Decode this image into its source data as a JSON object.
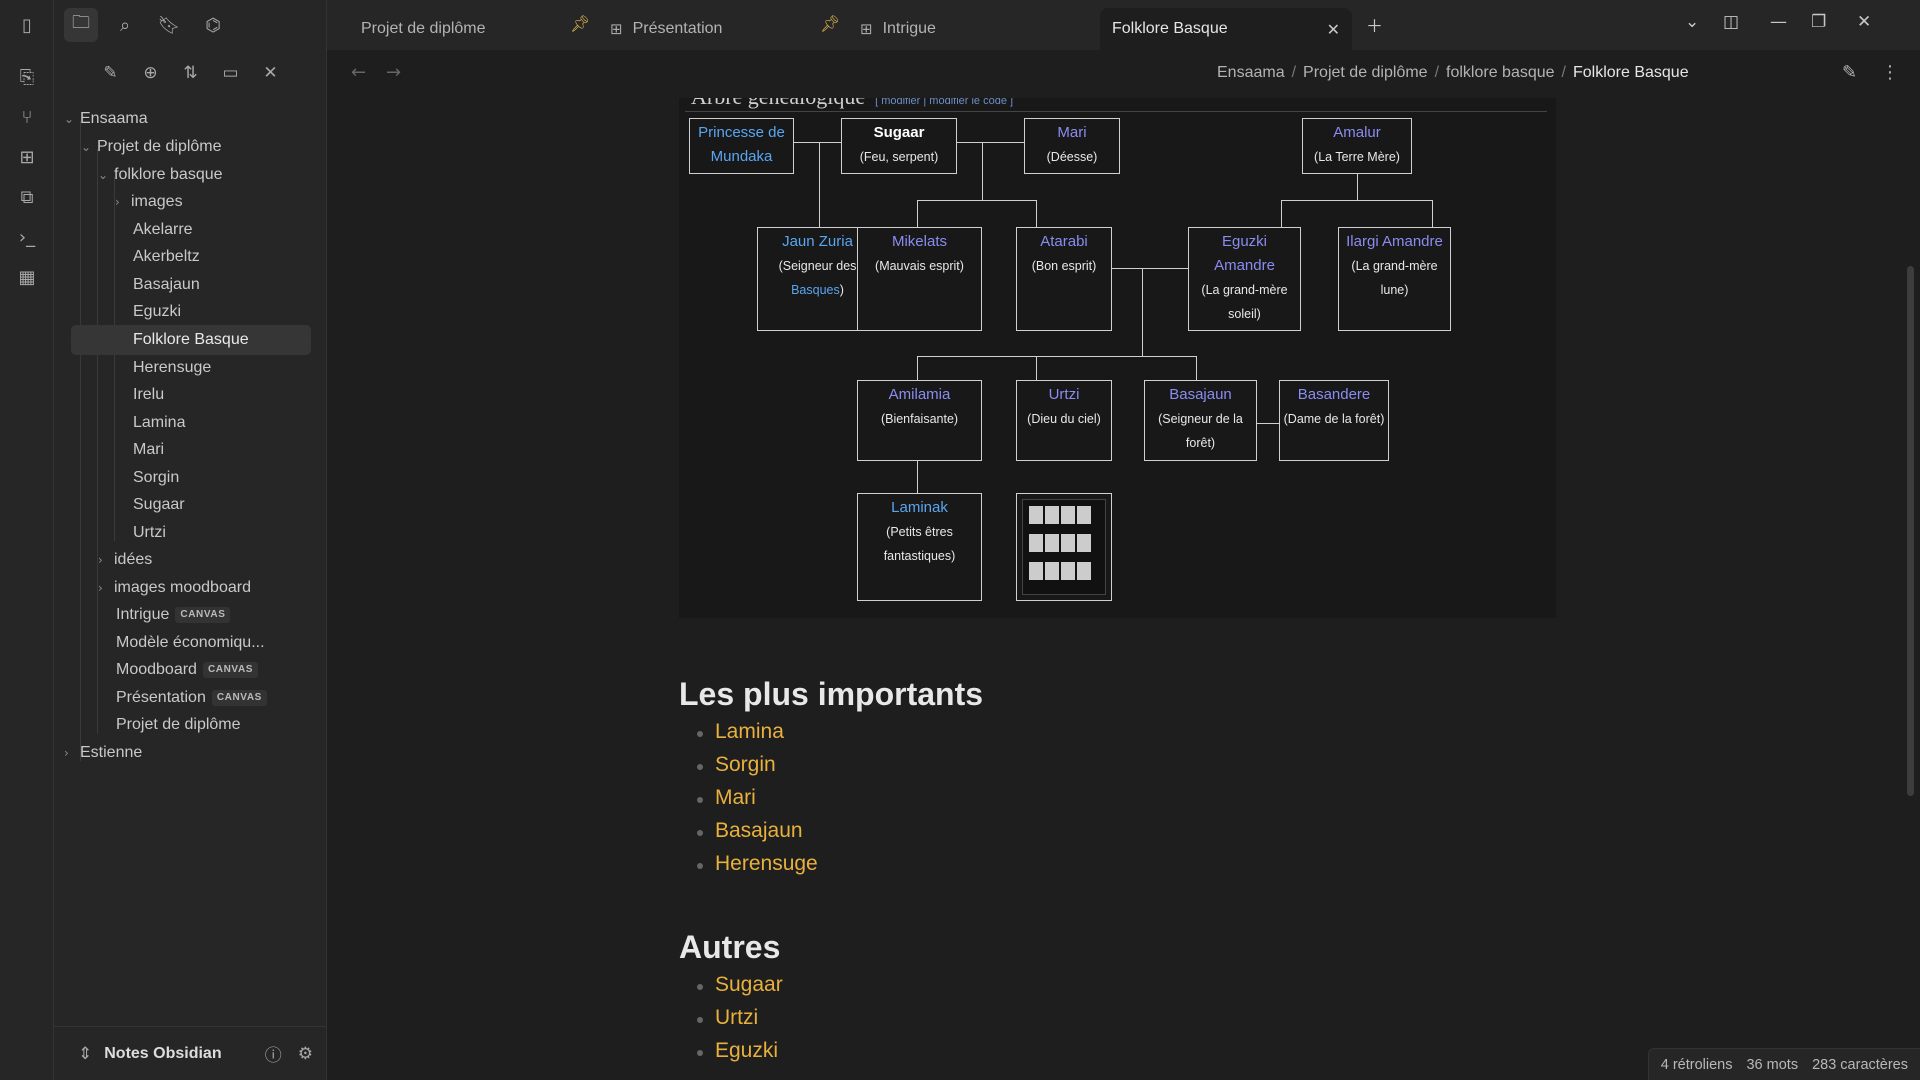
{
  "tabs": [
    {
      "label": "Projet de diplôme",
      "pinned": true
    },
    {
      "label": "Présentation",
      "pinned": true,
      "icon": "canvas-icon"
    },
    {
      "label": "Intrigue",
      "icon": "canvas-icon"
    },
    {
      "label": "Folklore Basque",
      "active": true
    }
  ],
  "breadcrumb": [
    "Ensaama",
    "Projet de diplôme",
    "folklore basque",
    "Folklore Basque"
  ],
  "tree": {
    "root1": "Ensaama",
    "projet": "Projet de diplôme",
    "folklore": "folklore basque",
    "images": "images",
    "files": [
      "Akelarre",
      "Akerbeltz",
      "Basajaun",
      "Eguzki",
      "Folklore Basque",
      "Herensuge",
      "Irelu",
      "Lamina",
      "Mari",
      "Sorgin",
      "Sugaar",
      "Urtzi"
    ],
    "idees": "idées",
    "moodboard_folder": "images moodboard",
    "intrigue": "Intrigue",
    "modele": "Modèle économiqu...",
    "moodboard": "Moodboard",
    "presentation": "Présentation",
    "projet_file": "Projet de diplôme",
    "root2": "Estienne",
    "canvas_badge": "CANVAS"
  },
  "vault": {
    "name": "Notes Obsidian"
  },
  "family_tree": {
    "caption": "Arbre généalogique",
    "caption_links": "[ modifier | modifier le code ]",
    "nodes": {
      "princesse": {
        "name": "Princesse de Mundaka"
      },
      "sugaar": {
        "name": "Sugaar",
        "desc": "(Feu, serpent)"
      },
      "mari": {
        "name": "Mari",
        "desc": "(Déesse)"
      },
      "amalur": {
        "name": "Amalur",
        "desc": "(La Terre Mère)"
      },
      "jaun": {
        "name": "Jaun Zuria",
        "desc": "(Seigneur des",
        "desc_link": "Basques",
        "desc_end": ")"
      },
      "mikelats": {
        "name": "Mikelats",
        "desc": "(Mauvais esprit)"
      },
      "atarabi": {
        "name": "Atarabi",
        "desc": "(Bon esprit)"
      },
      "eguzki": {
        "name": "Eguzki Amandre",
        "desc": "(La grand-mère soleil)"
      },
      "ilargi": {
        "name": "Ilargi Amandre",
        "desc": "(La grand-mère lune)"
      },
      "amilamia": {
        "name": "Amilamia",
        "desc": "(Bienfaisante)"
      },
      "urtzi": {
        "name": "Urtzi",
        "desc": "(Dieu du ciel)"
      },
      "basajaun": {
        "name": "Basajaun",
        "desc": "(Seigneur de la forêt)"
      },
      "basandere": {
        "name": "Basandere",
        "desc": "(Dame de la forêt)"
      },
      "laminak": {
        "name": "Laminak",
        "desc": "(Petits êtres fantastiques)"
      }
    }
  },
  "sections": [
    {
      "title": "Les plus importants",
      "items": [
        "Lamina",
        "Sorgin",
        "Mari",
        "Basajaun",
        "Herensuge"
      ]
    },
    {
      "title": "Autres",
      "items": [
        "Sugaar",
        "Urtzi",
        "Eguzki"
      ]
    }
  ],
  "status": {
    "backlinks": "4 rétroliens",
    "words": "36 mots",
    "chars": "283 caractères"
  },
  "colors": {
    "accent": "#e8b03d",
    "link_purple": "#8a8cf0",
    "link_blue": "#5aa5f0",
    "pin": "#e0b450"
  }
}
